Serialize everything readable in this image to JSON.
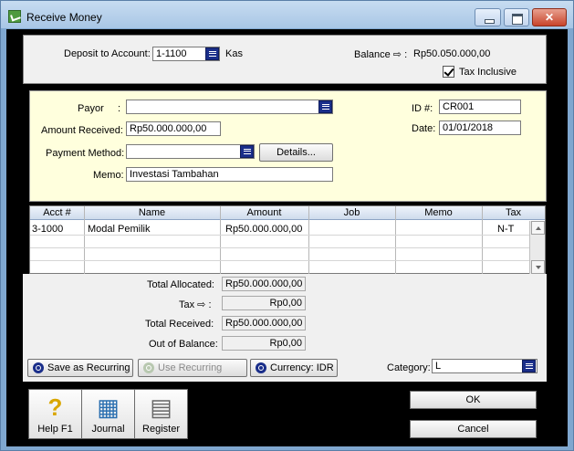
{
  "window": {
    "title": "Receive Money",
    "close_glyph": "✕"
  },
  "header": {
    "deposit_label": "Deposit to Account:",
    "deposit_account": "1-1100",
    "deposit_name": "Kas",
    "balance_label": "Balance ⇨ :",
    "balance_value": "Rp50.050.000,00",
    "tax_inclusive_label": "Tax Inclusive",
    "tax_inclusive_checked": true
  },
  "form": {
    "payor_label": "Payor",
    "payor_colon": ":",
    "payor_value": "",
    "amount_label": "Amount Received:",
    "amount_value": "Rp50.000.000,00",
    "method_label": "Payment Method:",
    "method_value": "",
    "details_label": "Details...",
    "memo_label": "Memo:",
    "memo_value": "Investasi Tambahan",
    "id_label": "ID #:",
    "id_value": "CR001",
    "date_label": "Date:",
    "date_value": "01/01/2018"
  },
  "grid": {
    "columns": [
      "Acct #",
      "Name",
      "Amount",
      "Job",
      "Memo",
      "Tax"
    ],
    "rows": [
      {
        "acct": "3-1000",
        "name": "Modal Pemilik",
        "amount": "Rp50.000.000,00",
        "job": "",
        "memo": "",
        "tax": "N-T"
      }
    ]
  },
  "totals": {
    "allocated_label": "Total Allocated:",
    "allocated_value": "Rp50.000.000,00",
    "tax_label": "Tax ⇨ :",
    "tax_value": "Rp0,00",
    "received_label": "Total Received:",
    "received_value": "Rp50.000.000,00",
    "out_label": "Out of Balance:",
    "out_value": "Rp0,00"
  },
  "actions": {
    "save_recurring": "Save as Recurring",
    "use_recurring": "Use Recurring",
    "currency": "Currency:  IDR",
    "category_label": "Category:",
    "category_value": "L"
  },
  "footer": {
    "help": "Help F1",
    "journal": "Journal",
    "register": "Register",
    "ok": "OK",
    "cancel": "Cancel"
  }
}
